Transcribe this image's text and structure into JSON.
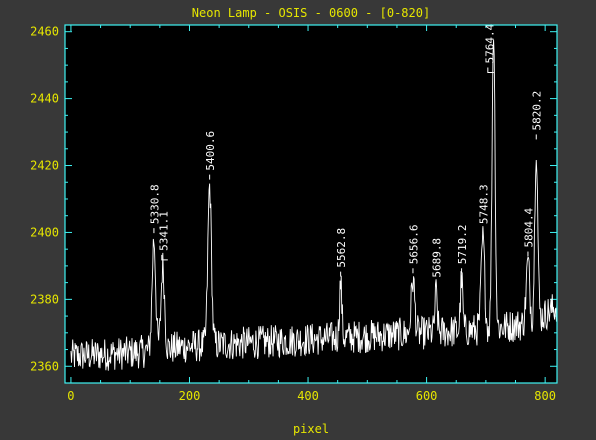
{
  "colors": {
    "background": "#383838",
    "plot_area": "#000000",
    "frame": "#3ff3f3",
    "text": "#e6e600",
    "trace": "#ffffff"
  },
  "chart_data": {
    "type": "line",
    "title": "Neon Lamp - OSIS - 0600 - [0-820]",
    "xlabel": "pixel",
    "ylabel": "",
    "xlim": [
      -10,
      820
    ],
    "ylim": [
      2355,
      2462
    ],
    "xticks": [
      0,
      200,
      400,
      600,
      800
    ],
    "yticks": [
      2360,
      2380,
      2400,
      2420,
      2440,
      2460
    ],
    "grid": false,
    "baseline": [
      [
        0,
        2363
      ],
      [
        100,
        2364
      ],
      [
        200,
        2366
      ],
      [
        300,
        2367
      ],
      [
        400,
        2368
      ],
      [
        500,
        2369
      ],
      [
        600,
        2370
      ],
      [
        700,
        2371
      ],
      [
        780,
        2373
      ],
      [
        820,
        2378
      ]
    ],
    "noise_amplitude": 5,
    "peaks": [
      {
        "x": 140,
        "y": 2398,
        "width": 3
      },
      {
        "x": 155,
        "y": 2390,
        "width": 3
      },
      {
        "x": 234,
        "y": 2414,
        "width": 3
      },
      {
        "x": 455,
        "y": 2385,
        "width": 2
      },
      {
        "x": 577,
        "y": 2386,
        "width": 3
      },
      {
        "x": 616,
        "y": 2382,
        "width": 2
      },
      {
        "x": 659,
        "y": 2386,
        "width": 2
      },
      {
        "x": 695,
        "y": 2398,
        "width": 3
      },
      {
        "x": 713,
        "y": 2461,
        "width": 2.5
      },
      {
        "x": 771,
        "y": 2391,
        "width": 3
      },
      {
        "x": 785,
        "y": 2426,
        "width": 2.5
      }
    ],
    "annotations": [
      {
        "x": 140,
        "y": 2398,
        "label": "5330.8",
        "style": "dash"
      },
      {
        "x": 155,
        "y": 2390,
        "label": "5341.1",
        "style": "bracket"
      },
      {
        "x": 234,
        "y": 2414,
        "label": "5400.6",
        "style": "dash"
      },
      {
        "x": 455,
        "y": 2385,
        "label": "5562.8",
        "style": "dash"
      },
      {
        "x": 577,
        "y": 2386,
        "label": "5656.6",
        "style": "dash"
      },
      {
        "x": 616,
        "y": 2382,
        "label": "5689.8",
        "style": "dash"
      },
      {
        "x": 659,
        "y": 2386,
        "label": "5719.2",
        "style": "dash"
      },
      {
        "x": 695,
        "y": 2398,
        "label": "5748.3",
        "style": "dash"
      },
      {
        "x": 705,
        "y": 2446,
        "label": "5764.4",
        "style": "bracket"
      },
      {
        "x": 771,
        "y": 2391,
        "label": "5804.4",
        "style": "dash"
      },
      {
        "x": 785,
        "y": 2426,
        "label": "5820.2",
        "style": "dash"
      }
    ]
  }
}
